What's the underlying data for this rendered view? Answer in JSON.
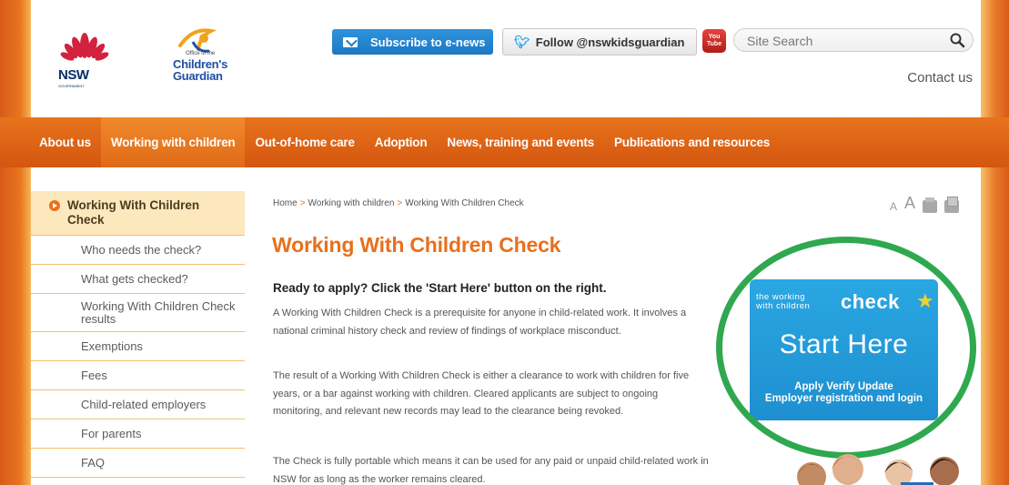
{
  "header": {
    "nsw_logo_text": "NSW",
    "nsw_logo_sub": "GOVERNMENT",
    "ocg_small": "Office of the",
    "ocg_name_line1": "Children's",
    "ocg_name_line2": "Guardian",
    "subscribe_label": "Subscribe to e-news",
    "follow_label": "Follow @nswkidsguardian",
    "youtube_label_top": "You",
    "youtube_label_bottom": "Tube",
    "search_placeholder": "Site Search",
    "contact_label": "Contact us"
  },
  "nav": {
    "items": [
      {
        "label": "About us"
      },
      {
        "label": "Working with children"
      },
      {
        "label": "Out-of-home care"
      },
      {
        "label": "Adoption"
      },
      {
        "label": "News, training and events"
      },
      {
        "label": "Publications and resources"
      }
    ]
  },
  "sidebar": {
    "heading": "Working With Children Check",
    "items": [
      {
        "label": "Who needs the check?"
      },
      {
        "label": "What gets checked?"
      },
      {
        "label": "Working With Children Check results"
      },
      {
        "label": "Exemptions"
      },
      {
        "label": "Fees"
      },
      {
        "label": "Child-related employers"
      },
      {
        "label": "For parents"
      },
      {
        "label": "FAQ"
      }
    ]
  },
  "breadcrumb": {
    "items": [
      "Home",
      "Working with children",
      "Working With Children Check"
    ],
    "separator": ">"
  },
  "tools": {
    "small_a": "A",
    "big_a": "A"
  },
  "main": {
    "title": "Working With Children Check",
    "subhead": "Ready to apply? Click the 'Start Here' button on the right.",
    "paragraphs": [
      "A Working With Children Check is a prerequisite for anyone in child-related work. It involves a national criminal history check and review of findings of  workplace misconduct.",
      "The result of a Working With Children Check is either a clearance to work with children for five years, or a bar against working with children. Cleared applicants are subject to ongoing monitoring, and relevant new records may lead to the clearance being revoked.",
      "The Check is fully portable which means it can be used for any paid or unpaid child-related work in NSW for as long as the worker remains cleared."
    ]
  },
  "check_panel": {
    "small_text_1": "the working",
    "small_text_2": "with children",
    "big_text": "check",
    "start_label": "Start Here",
    "links_line1": "Apply  Verify  Update",
    "links_line2": "Employer registration and login"
  },
  "colors": {
    "accent": "#e8701c",
    "nav": "#d45610",
    "panel": "#1e8fd0",
    "highlight_circle": "#2fa84f"
  }
}
